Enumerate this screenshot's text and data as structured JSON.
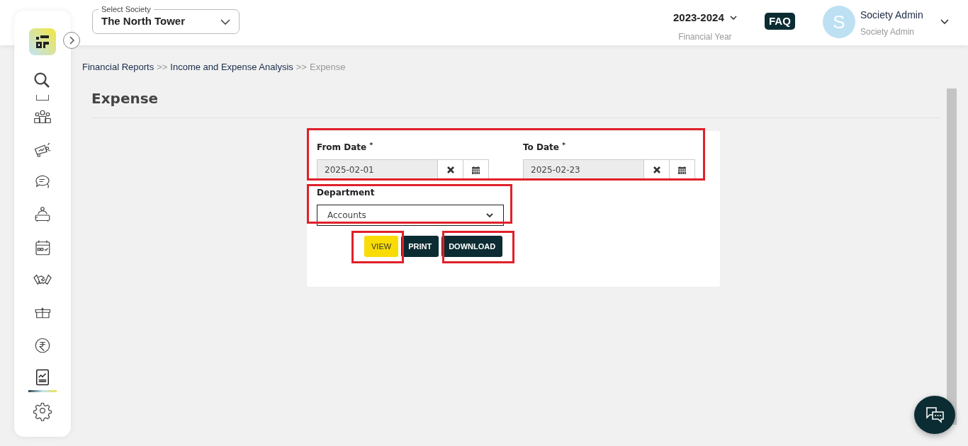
{
  "sidebar": {
    "items": [
      {
        "selected": false
      },
      {
        "selected": false
      },
      {
        "selected": false
      },
      {
        "selected": false
      },
      {
        "selected": false
      },
      {
        "selected": false
      },
      {
        "selected": false
      },
      {
        "selected": false
      },
      {
        "selected": false
      },
      {
        "selected": true
      },
      {
        "selected": false
      }
    ]
  },
  "header": {
    "society_select": {
      "label": "Select Society",
      "value": "The North Tower"
    },
    "financial_year": {
      "value": "2023-2024",
      "label": "Financial Year"
    },
    "faq": "FAQ",
    "user": {
      "initial": "S",
      "name": "Society Admin",
      "role": "Society Admin"
    }
  },
  "breadcrumb": [
    "Financial Reports",
    ">>",
    "Income and Expense Analysis",
    ">>",
    "Expense"
  ],
  "page_title": "Expense",
  "form": {
    "from_date": {
      "label": "From Date",
      "required_mark": "*",
      "value": "2025-02-01"
    },
    "to_date": {
      "label": "To Date",
      "required_mark": "*",
      "value": "2025-02-23"
    },
    "department": {
      "label": "Department",
      "value": "Accounts"
    },
    "buttons": [
      {
        "label": "VIEW",
        "kind": "primary"
      },
      {
        "label": "PRINT",
        "kind": "dark"
      },
      {
        "label": "DOWNLOAD",
        "kind": "dark"
      }
    ]
  }
}
